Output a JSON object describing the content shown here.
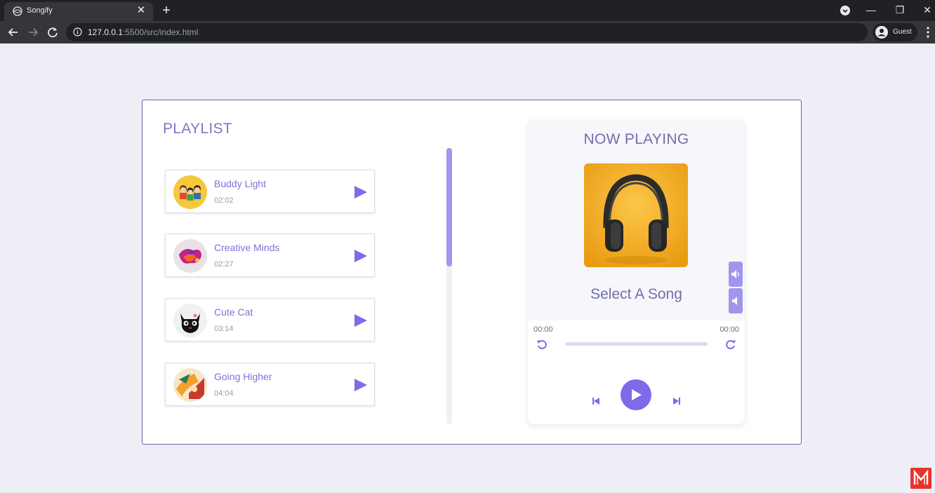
{
  "browser": {
    "tab_title": "Songify",
    "tab_close": "✕",
    "new_tab": "+",
    "url_host": "127.0.0.1",
    "url_path": ":5500/src/index.html",
    "profile_label": "Guest",
    "minimize": "—",
    "restore": "❐",
    "close": "✕"
  },
  "playlist": {
    "title": "PLAYLIST",
    "scroll_fraction": 0.43,
    "songs": [
      {
        "title": "Buddy Light",
        "duration": "02:02",
        "thumb": "kids-icon"
      },
      {
        "title": "Creative Minds",
        "duration": "02:27",
        "thumb": "paint-splash-icon"
      },
      {
        "title": "Cute Cat",
        "duration": "03:14",
        "thumb": "black-cat-icon"
      },
      {
        "title": "Going Higher",
        "duration": "04:04",
        "thumb": "abstract-art-icon"
      }
    ]
  },
  "player": {
    "heading": "NOW PLAYING",
    "cover": "headphones-icon",
    "song_label": "Select A Song",
    "current_time": "00:00",
    "total_time": "00:00",
    "progress": 0
  },
  "colors": {
    "accent": "#7d6be8",
    "accent_light": "#9f97ec",
    "text_purple": "#7a74d8",
    "frame_border": "#6a66a8",
    "page_bg": "#eeeef6"
  }
}
